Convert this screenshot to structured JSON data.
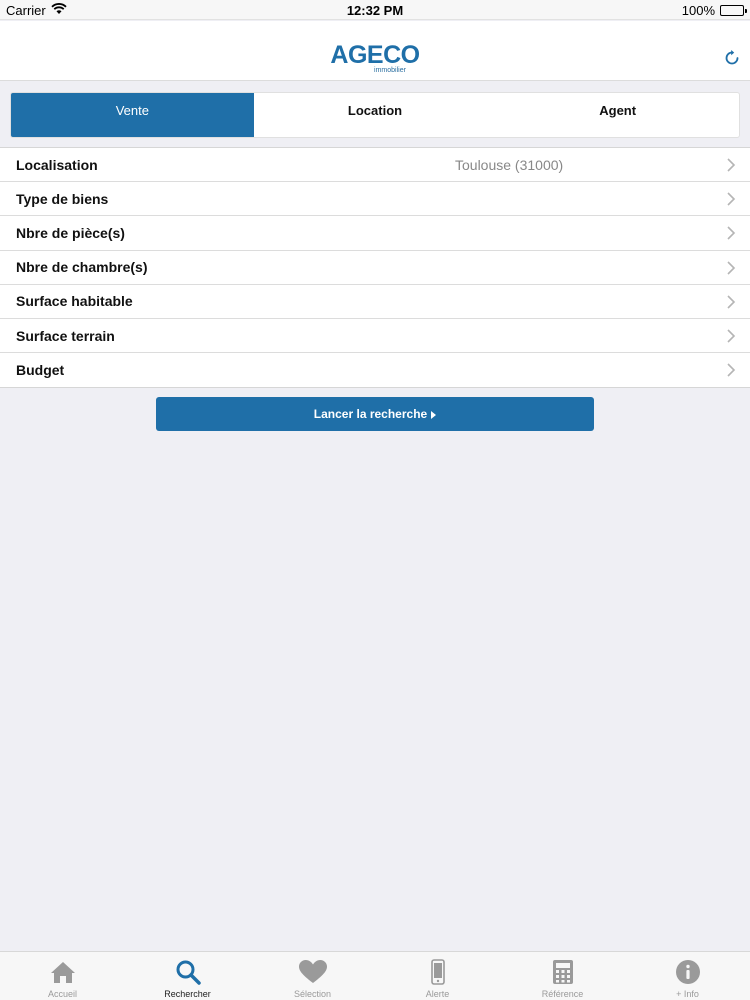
{
  "status_bar": {
    "carrier": "Carrier",
    "time": "12:32 PM",
    "battery": "100%"
  },
  "header": {
    "logo_main": "AGECO",
    "logo_sub": "immobilier"
  },
  "segments": [
    {
      "label": "Vente",
      "active": true
    },
    {
      "label": "Location",
      "active": false
    },
    {
      "label": "Agent",
      "active": false
    }
  ],
  "criteria": [
    {
      "label": "Localisation",
      "value": "Toulouse (31000)"
    },
    {
      "label": "Type de biens",
      "value": ""
    },
    {
      "label": "Nbre de pièce(s)",
      "value": ""
    },
    {
      "label": "Nbre de chambre(s)",
      "value": ""
    },
    {
      "label": "Surface habitable",
      "value": ""
    },
    {
      "label": "Surface terrain",
      "value": ""
    },
    {
      "label": "Budget",
      "value": ""
    }
  ],
  "search_button": {
    "label": "Lancer la recherche"
  },
  "tabs": [
    {
      "label": "Accueil",
      "icon": "home-icon",
      "active": false
    },
    {
      "label": "Rechercher",
      "icon": "search-icon",
      "active": true
    },
    {
      "label": "Sélection",
      "icon": "heart-icon",
      "active": false
    },
    {
      "label": "Alerte",
      "icon": "phone-icon",
      "active": false
    },
    {
      "label": "Référence",
      "icon": "calculator-icon",
      "active": false
    },
    {
      "label": "+ Info",
      "icon": "info-icon",
      "active": false
    }
  ],
  "colors": {
    "brand": "#1f6fa8",
    "background": "#efeff4",
    "inactive_tab": "#9a9a9a"
  }
}
